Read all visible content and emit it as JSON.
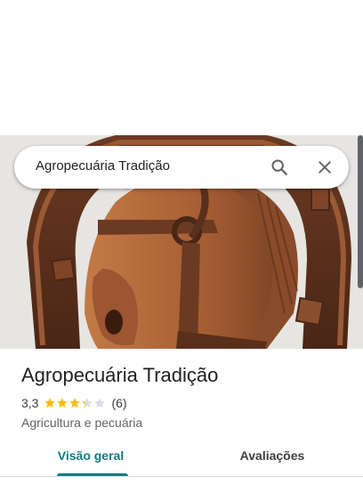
{
  "search": {
    "query": "Agropecuária Tradição"
  },
  "place": {
    "name": "Agropecuária Tradição",
    "rating": "3,3",
    "rating_value": 3.3,
    "stars_max": 5,
    "reviews_count": "(6)",
    "category": "Agricultura e pecuária"
  },
  "tabs": [
    {
      "label": "Visão geral",
      "active": true
    },
    {
      "label": "Avaliações",
      "active": false
    }
  ],
  "colors": {
    "accent": "#0f7b83",
    "star_filled": "#fbbc04",
    "star_empty": "#dadce0"
  },
  "icons": {
    "search": "search-icon",
    "close": "close-icon",
    "star": "star-icon"
  }
}
